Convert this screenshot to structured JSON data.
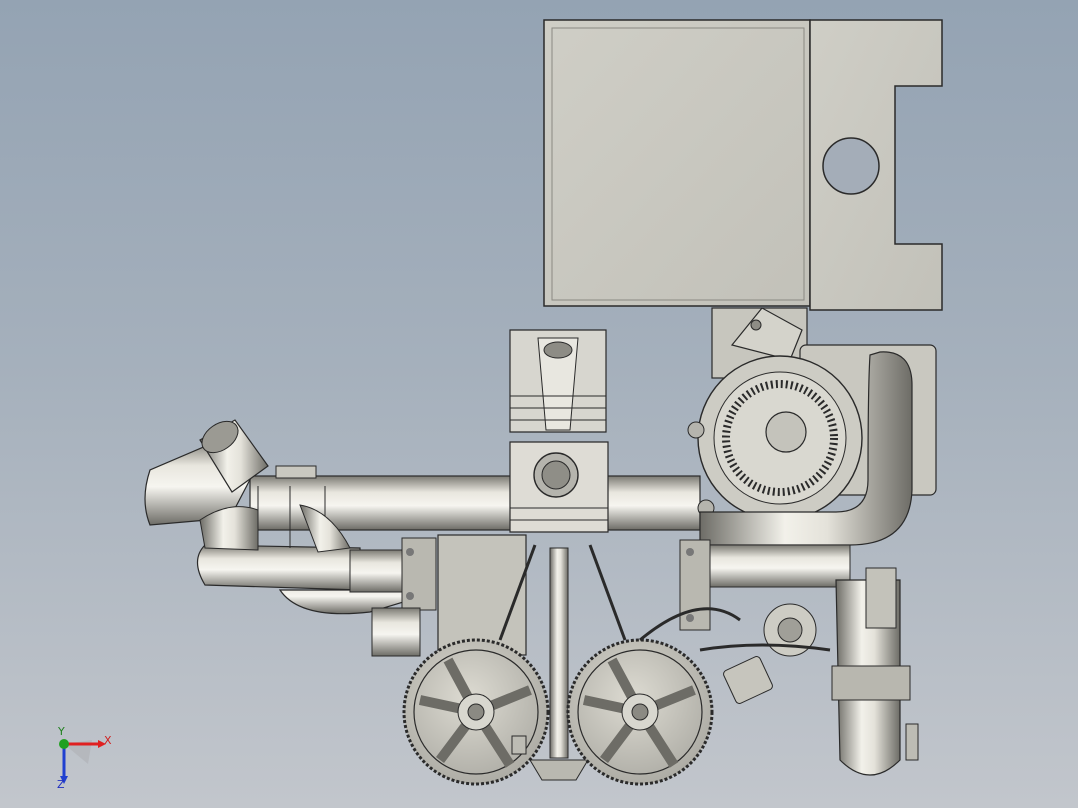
{
  "viewport": {
    "background_top": "#94a3b3",
    "background_bottom": "#c2c6cc",
    "part_fill": "#c9c8c0",
    "part_stroke": "#2a2a2a",
    "metal_light": "#e6e4dc",
    "metal_dark": "#6f6e68"
  },
  "triad": {
    "x_label": "X",
    "y_label": "Y",
    "z_label": "Z",
    "x_color": "#e02020",
    "y_color": "#20a020",
    "z_color": "#2040d0"
  }
}
